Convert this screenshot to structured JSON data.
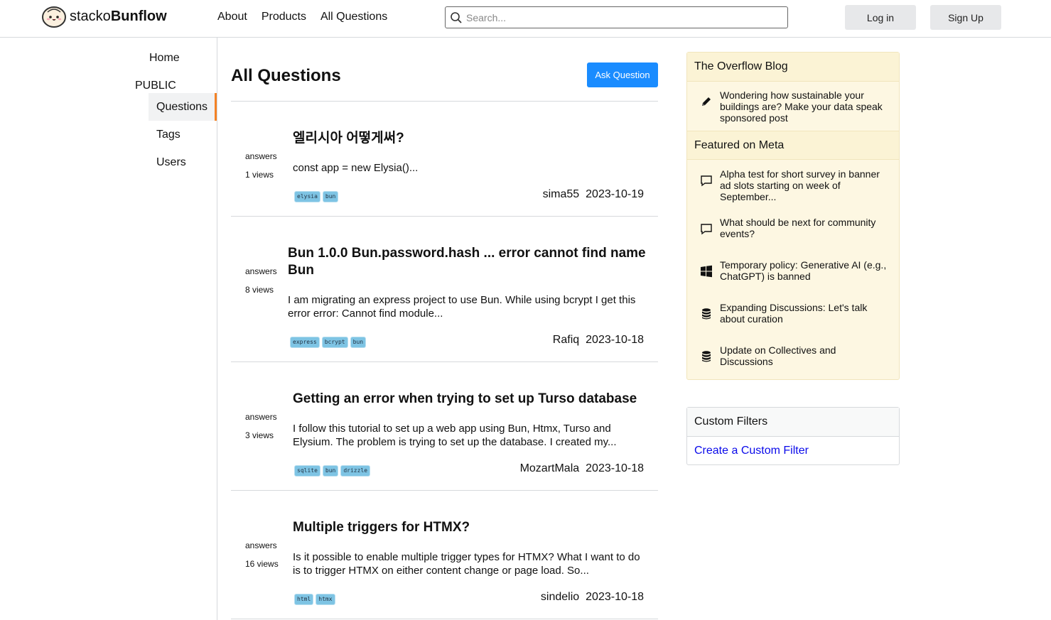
{
  "header": {
    "logo_prefix": "stacko",
    "logo_bold": "Bunflow",
    "nav": [
      "About",
      "Products",
      "All Questions"
    ],
    "search_placeholder": "Search...",
    "login_label": "Log in",
    "signup_label": "Sign Up"
  },
  "sidebar": {
    "home": "Home",
    "section": "PUBLIC",
    "items": [
      {
        "label": "Questions",
        "active": true
      },
      {
        "label": "Tags",
        "active": false
      },
      {
        "label": "Users",
        "active": false
      }
    ]
  },
  "main": {
    "title": "All Questions",
    "ask_label": "Ask Question",
    "questions": [
      {
        "answers_label": "answers",
        "views_label": "1 views",
        "title": "엘리시아 어떻게써?",
        "excerpt": "const app = new Elysia()...",
        "tags": [
          "elysia",
          "bun"
        ],
        "author": "sima55",
        "date": "2023-10-19"
      },
      {
        "answers_label": "answers",
        "views_label": "8 views",
        "title": "Bun 1.0.0 Bun.password.hash ... error cannot find name Bun",
        "excerpt": "I am migrating an express project to use Bun. While using bcrypt I get this error error: Cannot find module...",
        "tags": [
          "express",
          "bcrypt",
          "bun"
        ],
        "author": "Rafiq",
        "date": "2023-10-18"
      },
      {
        "answers_label": "answers",
        "views_label": "3 views",
        "title": "Getting an error when trying to set up Turso database",
        "excerpt": "I follow this tutorial to set up a web app using Bun, Htmx, Turso and Elysium. The problem is trying to set up the database. I created my...",
        "tags": [
          "sqlite",
          "bun",
          "drizzle"
        ],
        "author": "MozartMala",
        "date": "2023-10-18"
      },
      {
        "answers_label": "answers",
        "views_label": "16 views",
        "title": "Multiple triggers for HTMX?",
        "excerpt": "Is it possible to enable multiple trigger types for HTMX? What I want to do is to trigger HTMX on either content change or page load. So...",
        "tags": [
          "html",
          "htmx"
        ],
        "author": "sindelio",
        "date": "2023-10-18"
      }
    ]
  },
  "right": {
    "blog_heading": "The Overflow Blog",
    "blog_items": [
      {
        "icon": "pencil-icon",
        "text": "Wondering how sustainable your buildings are? Make your data speak sponsored post"
      }
    ],
    "meta_heading": "Featured on Meta",
    "meta_items": [
      {
        "icon": "chat-bubble-icon",
        "text": "Alpha test for short survey in banner ad slots starting on week of September..."
      },
      {
        "icon": "chat-bubble-icon",
        "text": "What should be next for community events?"
      },
      {
        "icon": "windows-icon",
        "text": "Temporary policy: Generative AI (e.g., ChatGPT) is banned"
      },
      {
        "icon": "database-icon",
        "text": "Expanding Discussions: Let's talk about curation"
      },
      {
        "icon": "database-icon",
        "text": "Update on Collectives and Discussions"
      }
    ],
    "filters_heading": "Custom Filters",
    "filters_link": "Create a Custom Filter"
  },
  "colors": {
    "accent_orange": "#f48225",
    "ask_blue": "#1a8cff",
    "tag_blue": "#7ec4e4",
    "blog_bg": "#fdf7e2",
    "link_blue": "#0a0aea"
  }
}
